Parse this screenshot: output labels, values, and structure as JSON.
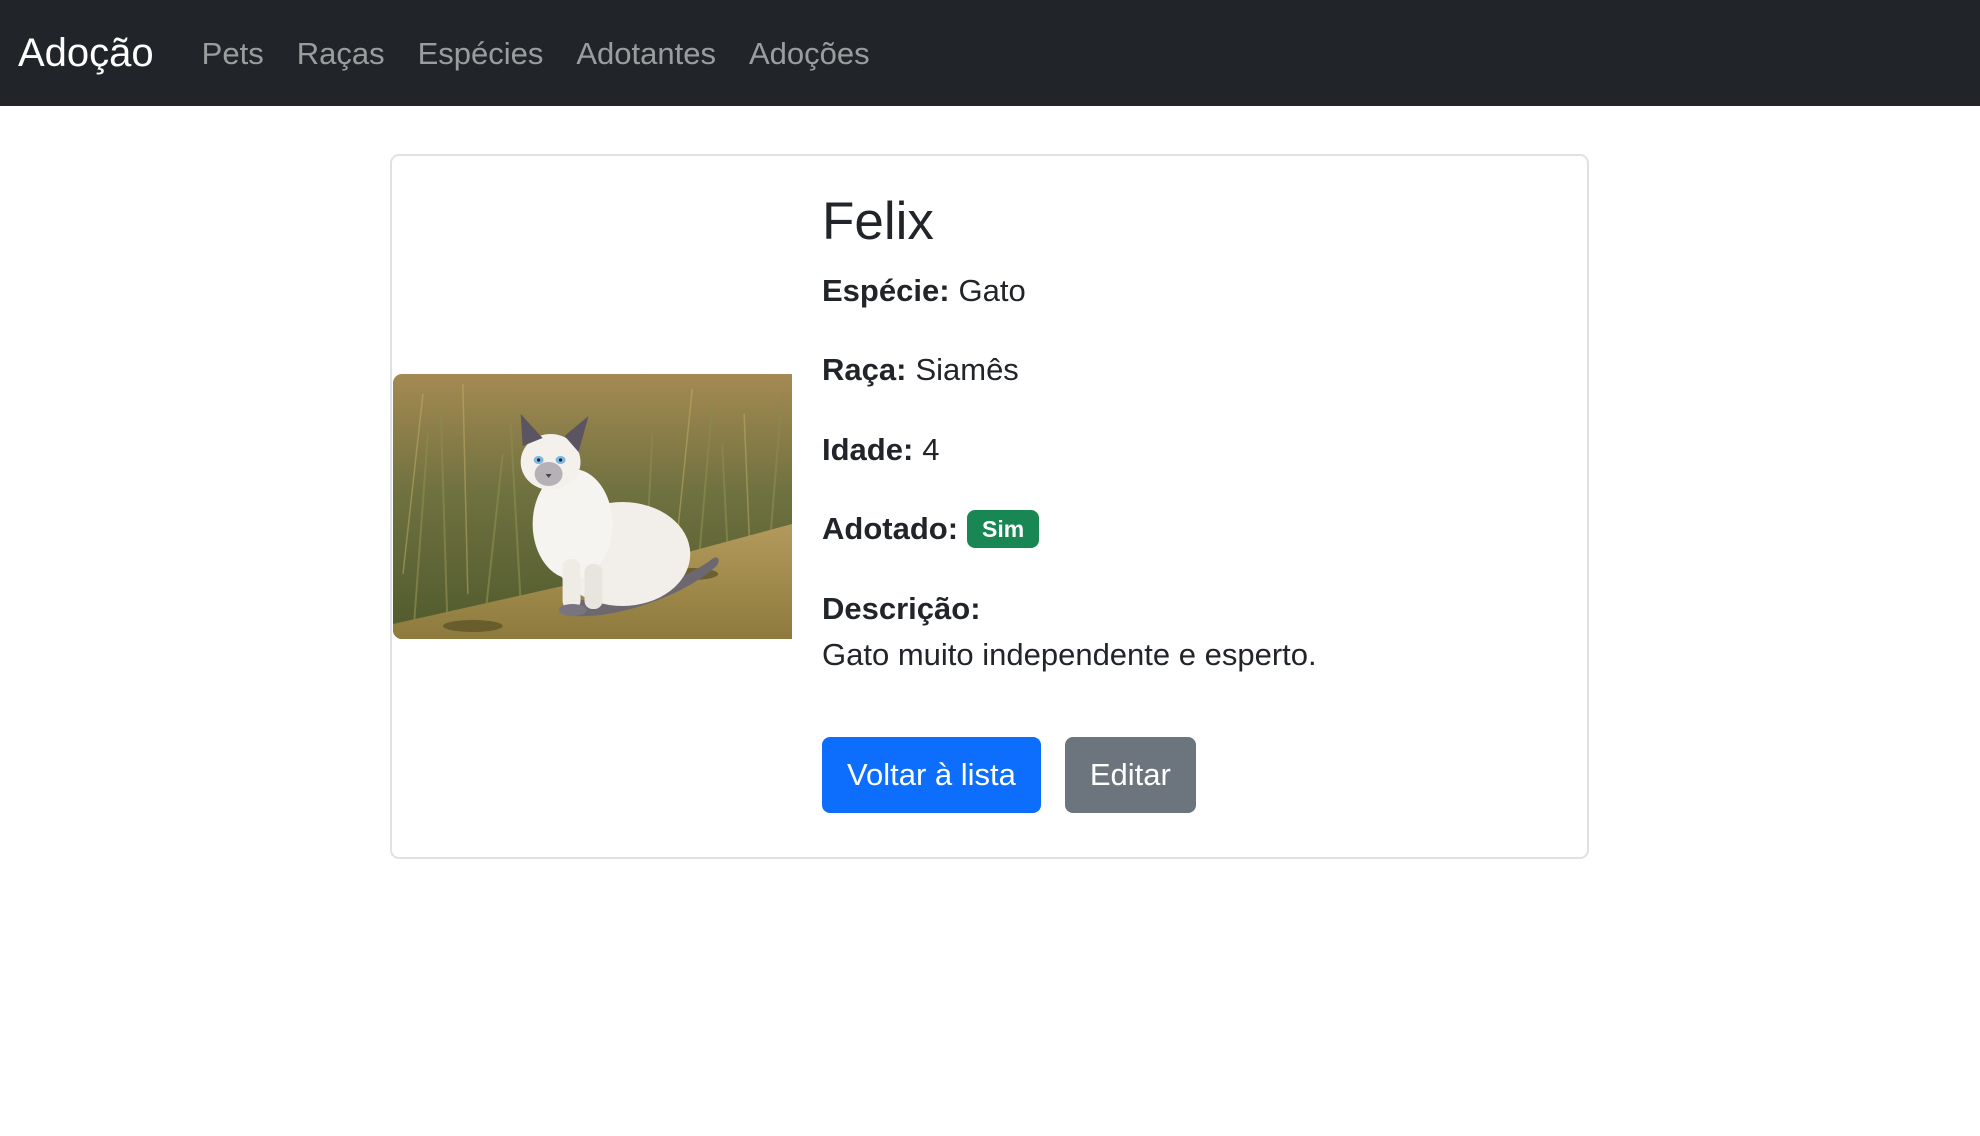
{
  "navbar": {
    "brand": "Adoção",
    "links": [
      "Pets",
      "Raças",
      "Espécies",
      "Adotantes",
      "Adoções"
    ]
  },
  "pet": {
    "name": "Felix",
    "image_alt": "Siamese cat photo",
    "fields": {
      "especie_label": "Espécie:",
      "especie_value": "Gato",
      "raca_label": "Raça:",
      "raca_value": "Siamês",
      "idade_label": "Idade:",
      "idade_value": "4",
      "adotado_label": "Adotado:",
      "adotado_badge": "Sim"
    },
    "descricao_label": "Descrição:",
    "descricao_text": "Gato muito independente e esperto."
  },
  "actions": {
    "back_label": "Voltar à lista",
    "edit_label": "Editar"
  },
  "colors": {
    "navbar_bg": "#212529",
    "primary": "#0d6efd",
    "secondary": "#6c757d",
    "success": "#198754"
  }
}
